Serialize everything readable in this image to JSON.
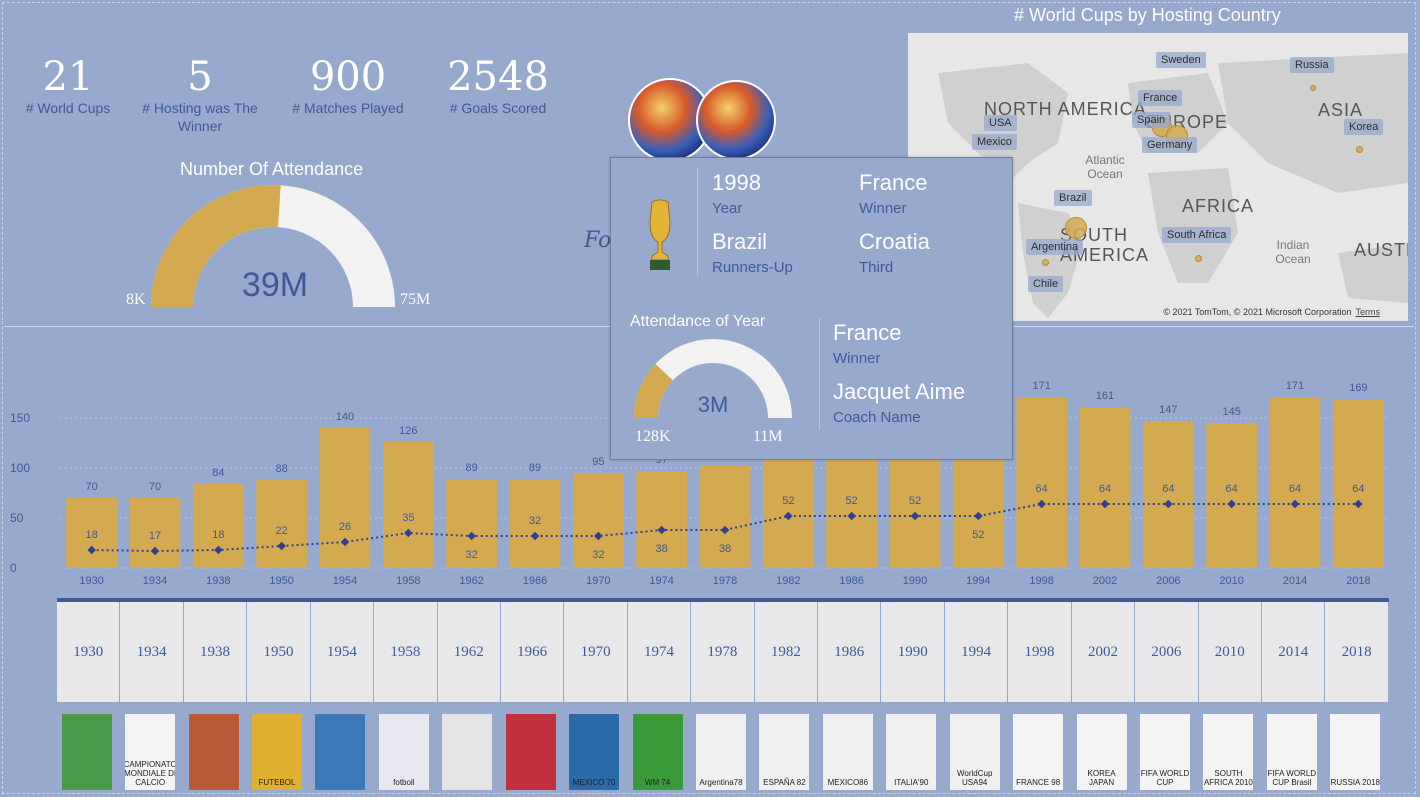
{
  "kpis": [
    {
      "value": "21",
      "label": "# World Cups"
    },
    {
      "value": "5",
      "label": "# Hosting was The Winner"
    },
    {
      "value": "900",
      "label": "# Matches Played"
    },
    {
      "value": "2548",
      "label": "# Goals Scored"
    }
  ],
  "attendance_gauge": {
    "title": "Number Of Attendance",
    "value_label": "39M",
    "min_label": "8K",
    "max_label": "75M",
    "fill_fraction": 0.52,
    "fill_color": "#d4aa50",
    "track_color": "#f2f2f2"
  },
  "map": {
    "title": "# World Cups by Hosting Country",
    "pins": [
      "Sweden",
      "Russia",
      "France",
      "Spain",
      "Germany",
      "USA",
      "Mexico",
      "Korea",
      "Brazil",
      "South Africa",
      "Argentina",
      "Chile"
    ],
    "regions": [
      "NORTH AMERICA",
      "EUROPE",
      "ASIA",
      "AFRICA",
      "SOUTH AMERICA",
      "AUSTR"
    ],
    "oceans": [
      "Atlantic Ocean",
      "Indian Ocean"
    ],
    "copyright": "© 2021 TomTom, © 2021 Microsoft Corporation",
    "terms": "Terms"
  },
  "tooltip": {
    "year": "1998",
    "year_label": "Year",
    "winner": "France",
    "winner_label": "Winner",
    "runner_up": "Brazil",
    "runner_up_label": "Runners-Up",
    "third": "Croatia",
    "third_label": "Third",
    "gauge_title": "Attendance of Year",
    "gauge_value": "3M",
    "gauge_min": "128K",
    "gauge_max": "11M",
    "gauge_fill_fraction": 0.24,
    "host": "France",
    "host_label": "Winner",
    "coach": "Jacquet Aime",
    "coach_label": "Coach Name",
    "icon": "trophy-icon"
  },
  "chart_data": {
    "type": "bar",
    "categories": [
      "1930",
      "1934",
      "1938",
      "1950",
      "1954",
      "1958",
      "1962",
      "1966",
      "1970",
      "1974",
      "1978",
      "1982",
      "1986",
      "1990",
      "1994",
      "1998",
      "2002",
      "2006",
      "2010",
      "2014",
      "2018"
    ],
    "series": [
      {
        "type": "bar",
        "values": [
          70,
          70,
          84,
          88,
          140,
          126,
          89,
          89,
          95,
          97,
          102,
          146,
          146,
          146,
          146,
          171,
          161,
          147,
          145,
          171,
          169
        ],
        "color": "#d4aa50"
      },
      {
        "type": "line",
        "values": [
          18,
          17,
          18,
          22,
          26,
          35,
          32,
          32,
          32,
          38,
          38,
          52,
          52,
          52,
          52,
          64,
          64,
          64,
          64,
          64,
          64
        ],
        "color": "#2e3f8f"
      }
    ],
    "bar_labels": [
      "70",
      "70",
      "84",
      "88",
      "140",
      "126",
      "89",
      "89",
      "95",
      "97",
      "",
      "",
      "",
      "",
      "",
      "171",
      "161",
      "147",
      "145",
      "171",
      "169"
    ],
    "line_labels": [
      "18",
      "17",
      "18",
      "22",
      "26",
      "35",
      "32",
      "32",
      "32",
      "38",
      "38",
      "52",
      "52",
      "52",
      "52",
      "64",
      "64",
      "64",
      "64",
      "64",
      "64"
    ],
    "yticks": [
      "0",
      "50",
      "100",
      "150"
    ],
    "ylim": [
      0,
      200
    ],
    "grid": true
  },
  "slicer": {
    "years": [
      "1930",
      "1934",
      "1938",
      "1950",
      "1954",
      "1958",
      "1962",
      "1966",
      "1970",
      "1974",
      "1978",
      "1982",
      "1986",
      "1990",
      "1994",
      "1998",
      "2002",
      "2006",
      "2010",
      "2014",
      "2018"
    ]
  },
  "posters": [
    {
      "caption": "",
      "color": "#4a9a4a"
    },
    {
      "caption": "CAMPIONATO MONDIALE DI CALCIO",
      "color": "#f4f4f4"
    },
    {
      "caption": "",
      "color": "#b85a3a"
    },
    {
      "caption": "FUTEBOL",
      "color": "#e0b030"
    },
    {
      "caption": "",
      "color": "#3a78b8"
    },
    {
      "caption": "fotboll",
      "color": "#e8e8f0"
    },
    {
      "caption": "",
      "color": "#e4e4e4"
    },
    {
      "caption": "",
      "color": "#c23040"
    },
    {
      "caption": "MEXICO 70",
      "color": "#2a6aa8"
    },
    {
      "caption": "WM 74",
      "color": "#3a9a3a"
    },
    {
      "caption": "Argentina78",
      "color": "#f0f0f0"
    },
    {
      "caption": "ESPAÑA 82",
      "color": "#f0f0f0"
    },
    {
      "caption": "MEXICO86",
      "color": "#f0f0f0"
    },
    {
      "caption": "ITALIA'90",
      "color": "#f0f0f0"
    },
    {
      "caption": "WorldCup USA94",
      "color": "#f0f0f0"
    },
    {
      "caption": "FRANCE 98",
      "color": "#f4f4f4"
    },
    {
      "caption": "KOREA JAPAN",
      "color": "#f4f4f4"
    },
    {
      "caption": "FIFA WORLD CUP",
      "color": "#f4f4f4"
    },
    {
      "caption": "SOUTH AFRICA 2010",
      "color": "#f4f4f4"
    },
    {
      "caption": "FIFA WORLD CUP Brasil",
      "color": "#f4f4f4"
    },
    {
      "caption": "RUSSIA 2018",
      "color": "#f4f4f4"
    }
  ]
}
